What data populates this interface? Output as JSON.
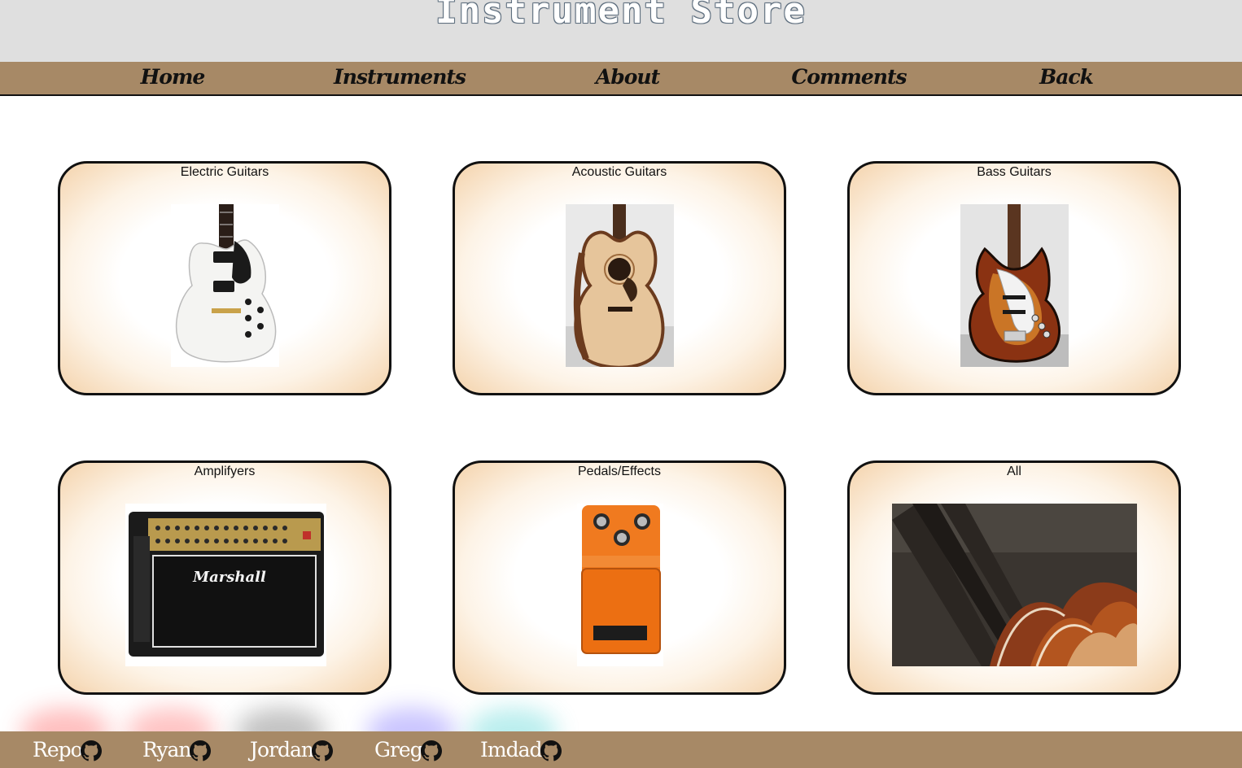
{
  "header": {
    "title": "Instrument Store"
  },
  "nav": {
    "items": [
      {
        "label": "Home"
      },
      {
        "label": "Instruments"
      },
      {
        "label": "About"
      },
      {
        "label": "Comments"
      },
      {
        "label": "Back"
      }
    ]
  },
  "categories": [
    {
      "title": "Electric Guitars",
      "image": "white-les-paul-electric-guitar"
    },
    {
      "title": "Acoustic Guitars",
      "image": "acoustic-guitar"
    },
    {
      "title": "Bass Guitars",
      "image": "sunburst-jazz-bass"
    },
    {
      "title": "Amplifyers",
      "image": "marshall-combo-amplifier"
    },
    {
      "title": "Pedals/Effects",
      "image": "orange-distortion-pedal"
    },
    {
      "title": "All",
      "image": "row-of-guitars"
    }
  ],
  "footer": {
    "links": [
      {
        "label": "Repo",
        "icon": "github-icon",
        "glow": "#ff4b4b"
      },
      {
        "label": "Ryan",
        "icon": "github-icon",
        "glow": "#ff5a5a"
      },
      {
        "label": "Jordan",
        "icon": "github-icon",
        "glow": "#555555"
      },
      {
        "label": "Greg",
        "icon": "github-icon",
        "glow": "#6a5cff"
      },
      {
        "label": "Imdad",
        "icon": "github-icon",
        "glow": "#3ccfcf"
      }
    ]
  },
  "colors": {
    "header_bg": "#dfdfdf",
    "bar_bg": "#a78966",
    "card_edge": "#f4d3ac"
  }
}
